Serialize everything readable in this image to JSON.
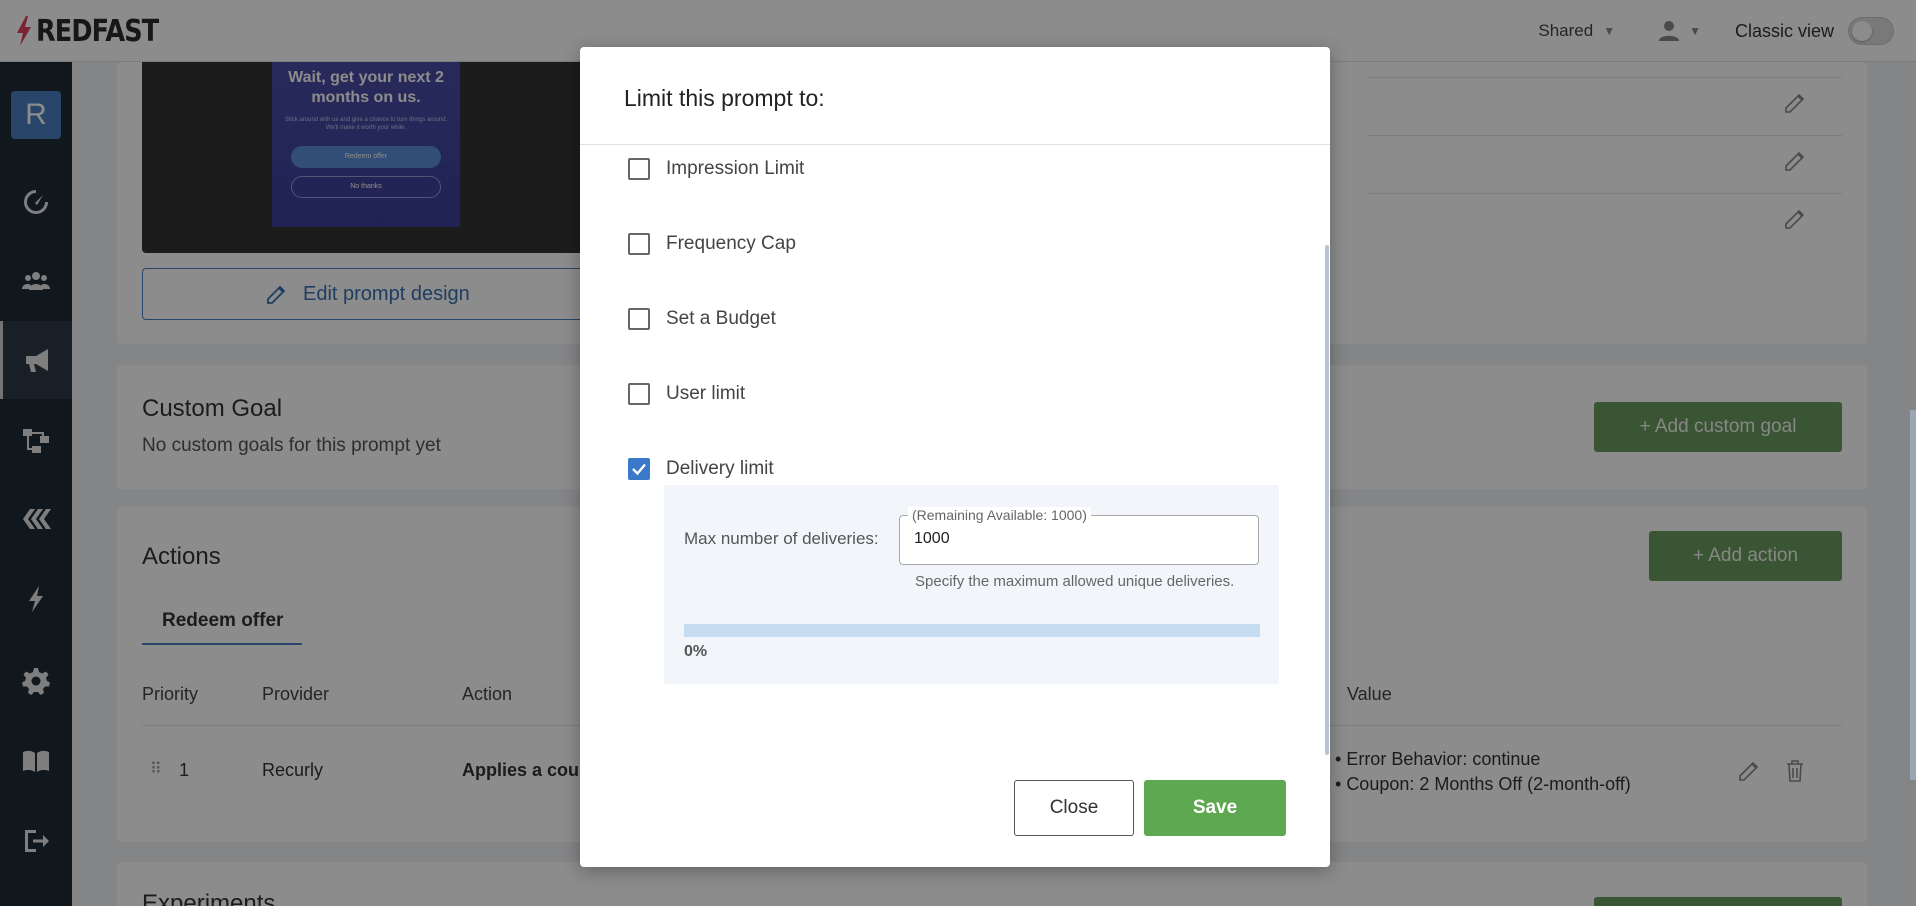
{
  "app": {
    "logo_text": "REDFAST"
  },
  "topbar": {
    "shared_label": "Shared",
    "classic_view_label": "Classic view"
  },
  "sidebar": {
    "avatar_letter": "R"
  },
  "prompt_preview": {
    "headline": "Wait, get your next 2 months on us.",
    "subtext": "Stick around with us and give a chance to turn things around. We'll make it worth your while.",
    "primary_btn": "Redeem offer",
    "secondary_btn": "No thanks"
  },
  "design": {
    "edit_label": "Edit prompt design"
  },
  "custom_goal": {
    "title": "Custom Goal",
    "empty_text": "No custom goals for this prompt yet",
    "add_label": "+ Add custom goal"
  },
  "actions": {
    "title": "Actions",
    "add_label": "+ Add action",
    "tab": "Redeem offer",
    "columns": {
      "priority": "Priority",
      "provider": "Provider",
      "action": "Action",
      "value": "Value"
    },
    "row": {
      "priority": "1",
      "provider": "Recurly",
      "action": "Applies a cou",
      "value_1": "Error Behavior: continue",
      "value_2": "Coupon: 2 Months Off (2-month-off)"
    }
  },
  "experiments": {
    "title": "Experiments"
  },
  "modal": {
    "title": "Limit this prompt to:",
    "options": [
      {
        "label": "Impression Limit",
        "checked": false
      },
      {
        "label": "Frequency Cap",
        "checked": false
      },
      {
        "label": "Set a Budget",
        "checked": false
      },
      {
        "label": "User limit",
        "checked": false
      },
      {
        "label": "Delivery limit",
        "checked": true
      }
    ],
    "delivery": {
      "label": "Max number of deliveries:",
      "legend": "(Remaining Available: 1000)",
      "value": "1000",
      "help": "Specify the maximum allowed unique deliveries.",
      "progress_percent": 0,
      "progress_label": "0%"
    },
    "close_label": "Close",
    "save_label": "Save"
  }
}
